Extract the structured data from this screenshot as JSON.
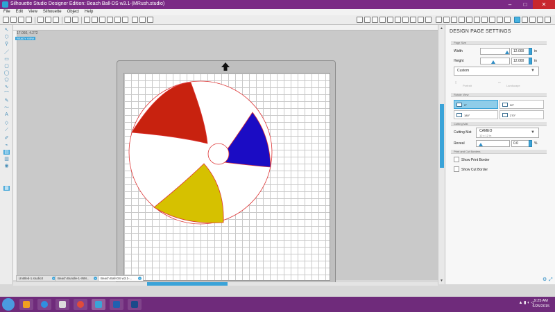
{
  "window": {
    "title": "Silhouette Studio Designer Edition: Beach Ball-DS w3.1-(MRush.studio)",
    "controls": {
      "minimize": "–",
      "maximize": "□",
      "close": "✕"
    }
  },
  "menu": [
    "File",
    "Edit",
    "View",
    "Silhouette",
    "Object",
    "Help"
  ],
  "workspace": {
    "coordinates": "17.060, 4.272",
    "ready_badge": "READY VIEW"
  },
  "panel": {
    "title": "DESIGN PAGE SETTINGS",
    "page_size_header": "Page Size",
    "width_label": "Width",
    "width_value": "12.000",
    "width_unit": "in",
    "width_level_fraction": 1.0,
    "height_label": "Height",
    "height_value": "12.000",
    "height_unit": "in",
    "height_level_fraction": 0.42,
    "size_preset": "Custom",
    "portrait_label": "Portrait",
    "landscape_label": "Landscape",
    "rotate_header": "Rotate View",
    "rotations": [
      "0°",
      "90°",
      "180°",
      "270°"
    ],
    "rotation_selected": "0°",
    "cutting_mat_header": "Cutting Mat",
    "cutting_mat_label": "Cutting Mat",
    "cutting_mat_value": "CAMEO",
    "cutting_mat_size": "12 x 12 in",
    "reveal_label": "Reveal",
    "reveal_value": "0.0",
    "reveal_unit": "%",
    "borders_header": "Print and Cut Borders",
    "show_print_border": "Show Print Border",
    "show_cut_border": "Show Cut Border"
  },
  "tabs": [
    {
      "label": "Untitled-1.studio3",
      "active": false
    },
    {
      "label": "Beach Bundle-1-INM...",
      "active": false
    },
    {
      "label": "Beach Ball-DS w3.1-...",
      "active": true
    }
  ],
  "taskbar": {
    "apps": [
      "outlook",
      "internet-explorer",
      "app-grid",
      "chrome",
      "silhouette-studio",
      "file-manager"
    ],
    "time": "9:25 AM",
    "date": "6/25/2015"
  },
  "colors": {
    "accent": "#3aa3d8",
    "title_bar": "#7b2a85",
    "ball_red": "#c8220f",
    "ball_blue": "#1b0cc4",
    "ball_yellow": "#d6c100",
    "ball_white": "#ffffff"
  }
}
